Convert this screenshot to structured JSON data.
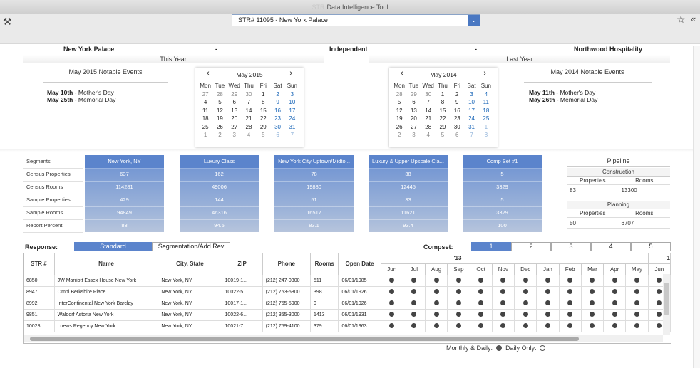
{
  "window": {
    "brand": "STR",
    "title": "Data Intelligence Tool"
  },
  "toolbar": {
    "selected_property": "STR# 11095 - New York Palace",
    "dropdown_glyph": "⌄",
    "wand_glyph": "⚒",
    "star_glyph": "☆",
    "collapse_glyph": "«"
  },
  "header": {
    "property": "New York Palace",
    "dash1": "-",
    "affiliation": "Independent",
    "dash2": "-",
    "management": "Northwood Hospitality"
  },
  "this_year": {
    "label": "This Year",
    "events_title": "May 2015 Notable Events",
    "events": [
      {
        "date": "May 10th",
        "name": " - Mother's Day"
      },
      {
        "date": "May 25th",
        "name": " - Memorial Day"
      }
    ],
    "calendar": {
      "title": "May 2015",
      "prev": "‹",
      "next": "›",
      "dows": [
        "Mon",
        "Tue",
        "Wed",
        "Thu",
        "Fri",
        "Sat",
        "Sun"
      ],
      "weeks": [
        [
          "27",
          "28",
          "29",
          "30",
          "1",
          "2",
          "3"
        ],
        [
          "4",
          "5",
          "6",
          "7",
          "8",
          "9",
          "10"
        ],
        [
          "11",
          "12",
          "13",
          "14",
          "15",
          "16",
          "17"
        ],
        [
          "18",
          "19",
          "20",
          "21",
          "22",
          "23",
          "24"
        ],
        [
          "25",
          "26",
          "27",
          "28",
          "29",
          "30",
          "31"
        ],
        [
          "1",
          "2",
          "3",
          "4",
          "5",
          "6",
          "7"
        ]
      ],
      "first_week_other": 4,
      "last_week_other": 7
    }
  },
  "last_year": {
    "label": "Last Year",
    "events_title": "May 2014 Notable Events",
    "events": [
      {
        "date": "May 11th",
        "name": " - Mother's Day"
      },
      {
        "date": "May 26th",
        "name": " - Memorial Day"
      }
    ],
    "calendar": {
      "title": "May 2014",
      "prev": "‹",
      "next": "›",
      "dows": [
        "Mon",
        "Tue",
        "Wed",
        "Thu",
        "Fri",
        "Sat",
        "Sun"
      ],
      "weeks": [
        [
          "28",
          "29",
          "30",
          "1",
          "2",
          "3",
          "4"
        ],
        [
          "5",
          "6",
          "7",
          "8",
          "9",
          "10",
          "11"
        ],
        [
          "12",
          "13",
          "14",
          "15",
          "16",
          "17",
          "18"
        ],
        [
          "19",
          "20",
          "21",
          "22",
          "23",
          "24",
          "25"
        ],
        [
          "26",
          "27",
          "28",
          "29",
          "30",
          "31",
          "1"
        ],
        [
          "2",
          "3",
          "4",
          "5",
          "6",
          "7",
          "8"
        ]
      ],
      "first_week_other": 3,
      "last_week_other": 6
    }
  },
  "segments": {
    "row_labels": [
      "Segments",
      "Census Properties",
      "Census Rooms",
      "Sample Properties",
      "Sample Rooms",
      "Report Percent"
    ],
    "columns": [
      {
        "name": "New York, NY",
        "values": [
          "637",
          "114281",
          "429",
          "94849",
          "83"
        ]
      },
      {
        "name": "Luxury Class",
        "values": [
          "162",
          "49006",
          "144",
          "46316",
          "94.5"
        ]
      },
      {
        "name": "New York City Uptown/Midto...",
        "values": [
          "78",
          "19880",
          "51",
          "16517",
          "83.1"
        ]
      },
      {
        "name": "Luxury & Upper Upscale Cla...",
        "values": [
          "38",
          "12445",
          "33",
          "11621",
          "93.4"
        ]
      },
      {
        "name": "Comp Set #1",
        "values": [
          "5",
          "3329",
          "5",
          "3329",
          "100"
        ]
      }
    ]
  },
  "pipeline": {
    "title": "Pipeline",
    "construction": {
      "title": "Construction",
      "h1": "Properties",
      "h2": "Rooms",
      "v1": "83",
      "v2": "13300"
    },
    "planning": {
      "title": "Planning",
      "h1": "Properties",
      "h2": "Rooms",
      "v1": "50",
      "v2": "6707"
    }
  },
  "response": {
    "label": "Response:",
    "tab_standard": "Standard",
    "tab_segmentation": "Segmentation/Add Rev"
  },
  "compset": {
    "label": "Compset:",
    "tabs": [
      "1",
      "2",
      "3",
      "4",
      "5"
    ],
    "active": "1"
  },
  "grid": {
    "headers": [
      "STR #",
      "Name",
      "City, State",
      "ZIP",
      "Phone",
      "Rooms",
      "Open Date"
    ],
    "year_label_1": "'13",
    "year_label_2": "'1",
    "months": [
      "Jun",
      "Jul",
      "Aug",
      "Sep",
      "Oct",
      "Nov",
      "Dec",
      "Jan",
      "Feb",
      "Mar",
      "Apr",
      "May",
      "Jun"
    ],
    "rows": [
      [
        "6850",
        "JW Marriott Essex House New York",
        "New York, NY",
        "10019-1...",
        "(212) 247-0300",
        "511",
        "06/01/1985"
      ],
      [
        "8947",
        "Omni Berkshire Place",
        "New York, NY",
        "10022-5...",
        "(212) 753-5800",
        "398",
        "06/01/1926"
      ],
      [
        "8992",
        "InterContinental New York Barclay",
        "New York, NY",
        "10017-1...",
        "(212) 755-5900",
        "0",
        "06/01/1926"
      ],
      [
        "9851",
        "Waldorf Astoria New York",
        "New York, NY",
        "10022-6...",
        "(212) 355-3000",
        "1413",
        "06/01/1931"
      ],
      [
        "10028",
        "Loews Regency New York",
        "New York, NY",
        "10021-7...",
        "(212) 759-4100",
        "379",
        "06/01/1963"
      ]
    ]
  },
  "legend": {
    "monthly_daily": "Monthly & Daily:",
    "daily_only": "Daily Only:"
  }
}
